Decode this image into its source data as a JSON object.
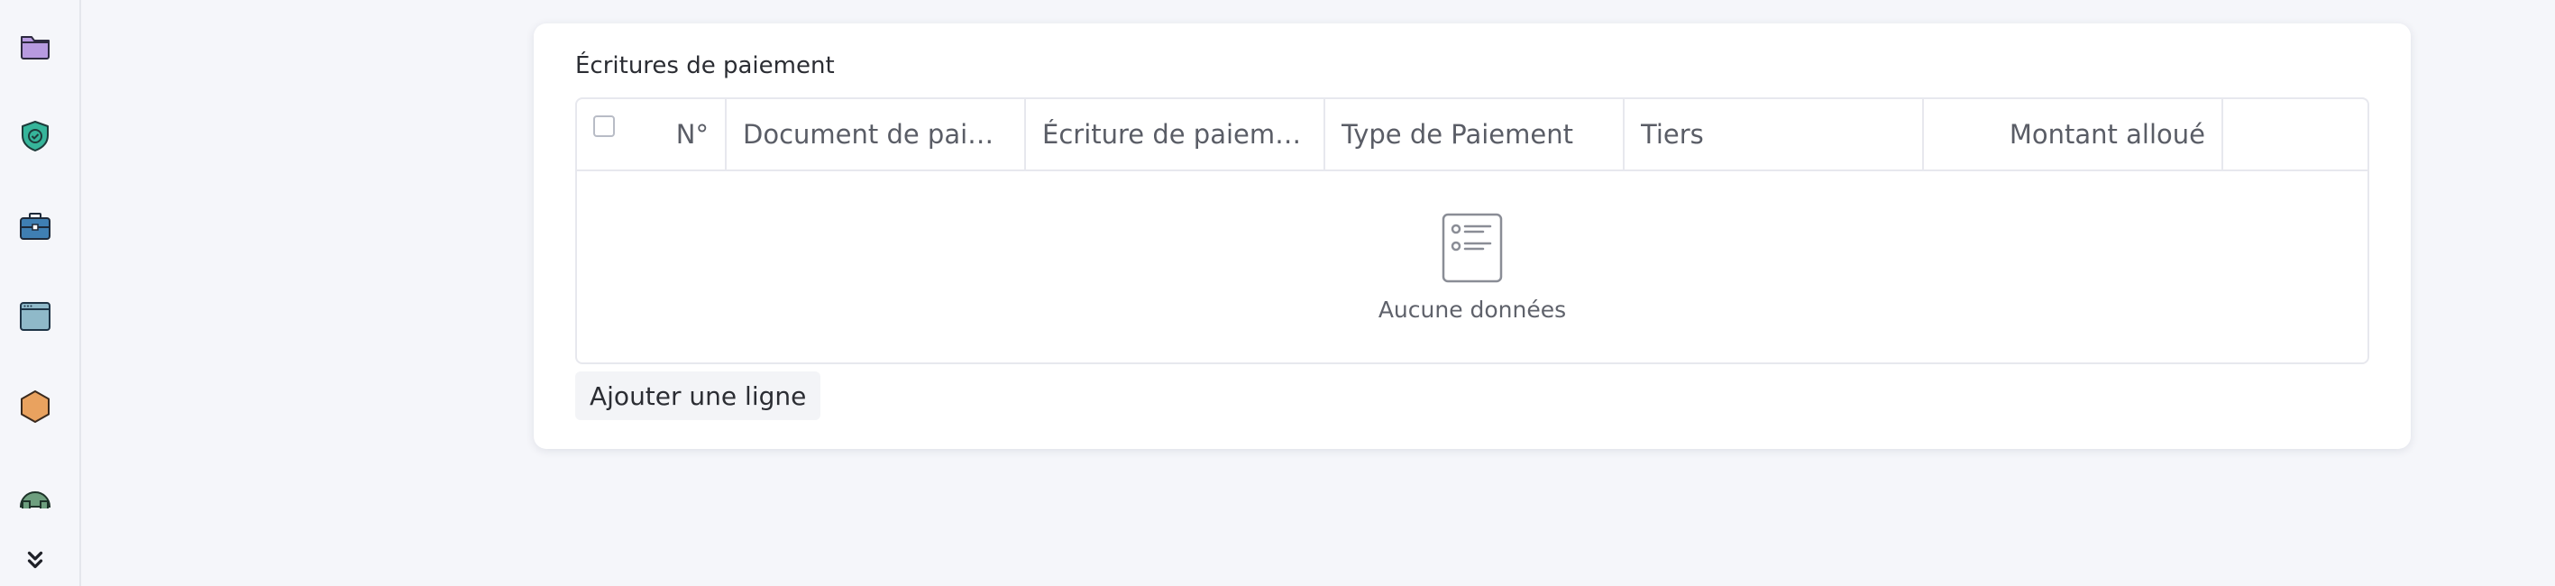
{
  "sidebar": {
    "icons": [
      "folder-icon",
      "shield-check-icon",
      "briefcase-icon",
      "window-icon",
      "hexagon-icon",
      "dome-icon"
    ],
    "colors": {
      "folder": "#b79ae0",
      "shield": "#36b59a",
      "briefcase": "#3f7fb3",
      "window": "#8fb9c9",
      "hexagon": "#e9a25f",
      "dome": "#6e9f7e"
    },
    "collapse_icon": "double-chevron-down-icon"
  },
  "section": {
    "title": "Écritures de paiement"
  },
  "table": {
    "columns": [
      {
        "label": "N°"
      },
      {
        "label": "Document de paiem…"
      },
      {
        "label": "Écriture de paiement"
      },
      {
        "label": "Type de Paiement"
      },
      {
        "label": "Tiers"
      },
      {
        "label": "Montant alloué"
      }
    ],
    "empty_text": "Aucune données"
  },
  "actions": {
    "add_row_label": "Ajouter une ligne"
  }
}
